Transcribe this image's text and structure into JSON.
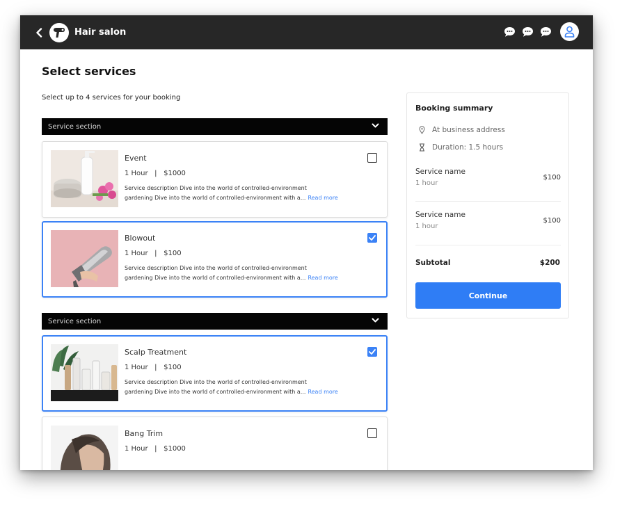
{
  "app": {
    "name": "Hair salon"
  },
  "icons": {
    "back": "chevron-left-icon",
    "logo": "hair-dryer-icon",
    "chat": "chat-bubble-icon",
    "user": "user-icon",
    "location": "map-pin-icon",
    "duration": "hourglass-icon",
    "section_toggle": "chevron-down-icon",
    "selected": "checkmark-icon"
  },
  "colors": {
    "accent": "#3b82f6",
    "topbar": "#272727",
    "section_bar": "#050505"
  },
  "page": {
    "title": "Select services",
    "subtitle": "Select up to 4 services for your booking"
  },
  "sections": [
    {
      "label": "Service section",
      "services": [
        {
          "name": "Event",
          "duration": "1 Hour",
          "price": "$1000",
          "desc_line1": "Service description Dive into the world of controlled-environment",
          "desc_line2": "gardening Dive into the world of controlled-environment with a...",
          "read_more": "Read more",
          "selected": false
        },
        {
          "name": "Blowout",
          "duration": "1 Hour",
          "price": "$100",
          "desc_line1": "Service description Dive into the world of controlled-environment",
          "desc_line2": "gardening Dive into the world of controlled-environment with a...",
          "read_more": "Read more",
          "selected": true
        }
      ]
    },
    {
      "label": "Service section",
      "services": [
        {
          "name": "Scalp Treatment",
          "duration": "1 Hour",
          "price": "$100",
          "desc_line1": "Service description Dive into the world of controlled-environment",
          "desc_line2": "gardening Dive into the world of controlled-environment with a...",
          "read_more": "Read more",
          "selected": true
        },
        {
          "name": "Bang Trim",
          "duration": "1 Hour",
          "price": "$1000",
          "selected": false
        }
      ]
    }
  ],
  "summary": {
    "title": "Booking summary",
    "location": "At business address",
    "duration": "Duration: 1.5 hours",
    "items": [
      {
        "name": "Service name",
        "duration": "1 hour",
        "price": "$100"
      },
      {
        "name": "Service name",
        "duration": "1 hour",
        "price": "$100"
      }
    ],
    "subtotal_label": "Subtotal",
    "subtotal_value": "$200",
    "continue_label": "Continue"
  }
}
